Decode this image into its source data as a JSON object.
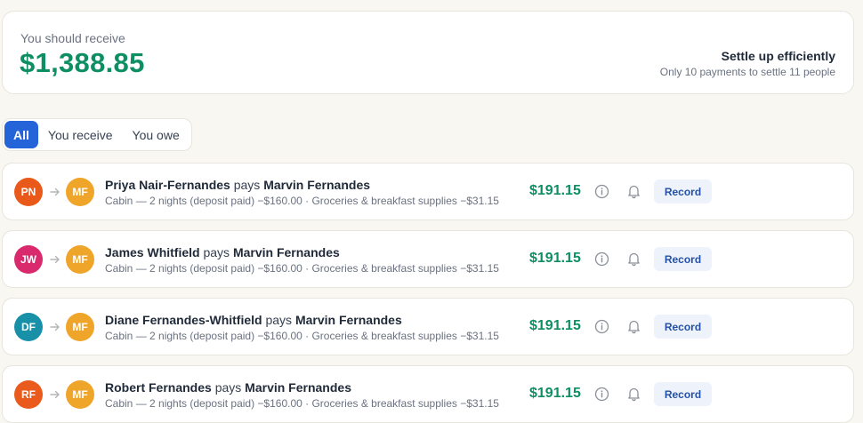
{
  "summary": {
    "label": "You should receive",
    "amount": "$1,388.85",
    "settle_title": "Settle up efficiently",
    "settle_subtitle": "Only 10 payments to settle 11 people"
  },
  "filters": [
    "All",
    "You receive",
    "You owe"
  ],
  "active_filter": "All",
  "connector": "pays",
  "colors": {
    "accent": "#2563d9",
    "positive": "#0e8f63",
    "receiver_avatar": "#eea52a"
  },
  "settlements": [
    {
      "from_initials": "PN",
      "from_name": "Priya Nair-Fernandes",
      "from_color": "#e9591a",
      "to_initials": "MF",
      "to_name": "Marvin Fernandes",
      "details": "Cabin — 2 nights (deposit paid) −$160.00 · Groceries & breakfast supplies −$31.15",
      "amount": "$191.15",
      "action": "Record"
    },
    {
      "from_initials": "JW",
      "from_name": "James Whitfield",
      "from_color": "#d82a6d",
      "to_initials": "MF",
      "to_name": "Marvin Fernandes",
      "details": "Cabin — 2 nights (deposit paid) −$160.00 · Groceries & breakfast supplies −$31.15",
      "amount": "$191.15",
      "action": "Record"
    },
    {
      "from_initials": "DF",
      "from_name": "Diane Fernandes-Whitfield",
      "from_color": "#1790a8",
      "to_initials": "MF",
      "to_name": "Marvin Fernandes",
      "details": "Cabin — 2 nights (deposit paid) −$160.00 · Groceries & breakfast supplies −$31.15",
      "amount": "$191.15",
      "action": "Record"
    },
    {
      "from_initials": "RF",
      "from_name": "Robert Fernandes",
      "from_color": "#ea5a1c",
      "to_initials": "MF",
      "to_name": "Marvin Fernandes",
      "details": "Cabin — 2 nights (deposit paid) −$160.00 · Groceries & breakfast supplies −$31.15",
      "amount": "$191.15",
      "action": "Record"
    }
  ]
}
